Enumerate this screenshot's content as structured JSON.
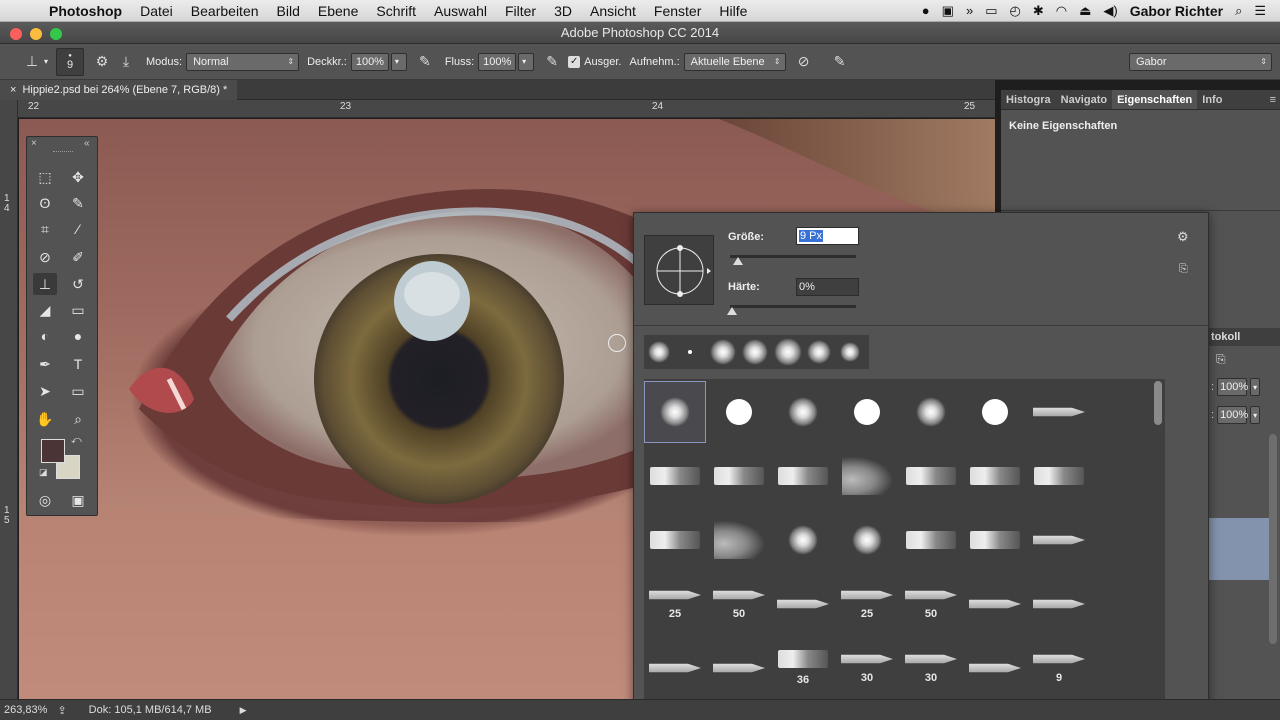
{
  "menubar": {
    "app": "Photoshop",
    "items": [
      "Datei",
      "Bearbeiten",
      "Bild",
      "Ebene",
      "Schrift",
      "Auswahl",
      "Filter",
      "3D",
      "Ansicht",
      "Fenster",
      "Hilfe"
    ],
    "user": "Gabor Richter"
  },
  "window": {
    "title": "Adobe Photoshop CC 2014"
  },
  "options": {
    "brush_size": "9",
    "mode_label": "Modus:",
    "mode_value": "Normal",
    "opacity_label": "Deckkr.:",
    "opacity_value": "100%",
    "flow_label": "Fluss:",
    "flow_value": "100%",
    "aligned_label": "Ausger.",
    "sample_label": "Aufnehm.:",
    "sample_value": "Aktuelle Ebene",
    "workspace": "Gabor"
  },
  "document": {
    "tab": "Hippie2.psd bei 264% (Ebene 7, RGB/8) *",
    "ruler_h": [
      "22",
      "23",
      "24",
      "25"
    ],
    "ruler_v": [
      "1\n4",
      "1\n5"
    ]
  },
  "panel": {
    "tabs": [
      "Histogra",
      "Navigato",
      "Eigenschaften",
      "Info"
    ],
    "active_tab": "Eigenschaften",
    "content": "Keine Eigenschaften",
    "protokoll": "tokoll",
    "opacity1": "100%",
    "opacity2": "100%"
  },
  "brush_popup": {
    "size_label": "Größe:",
    "size_value": "9 Px",
    "hardness_label": "Härte:",
    "hardness_value": "0%",
    "preset_numbers": [
      "25",
      "50",
      "25",
      "50",
      "36",
      "30",
      "30",
      "9"
    ]
  },
  "status": {
    "zoom": "263,83%",
    "doc": "Dok: 105,1 MB/614,7 MB"
  },
  "colors": {
    "foreground": "#4a3436",
    "background": "#d8d5c4"
  }
}
